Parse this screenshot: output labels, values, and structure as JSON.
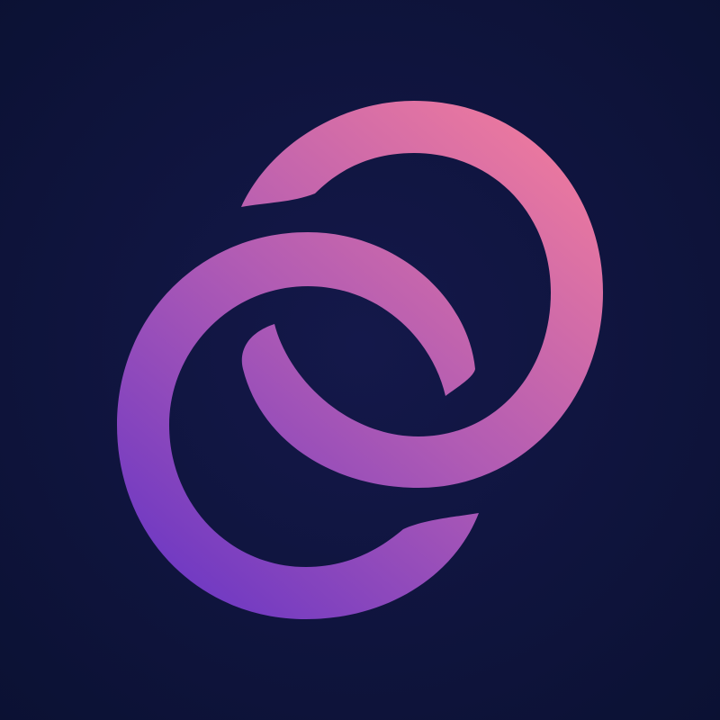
{
  "icon": {
    "name": "interlocking-rings-logo",
    "colors": {
      "background_center": "#14184a",
      "background_edge": "#0b1133",
      "gradient_top_right": "#ee7a9e",
      "gradient_mid": "#b05bb4",
      "gradient_bottom_left": "#6a36c4"
    }
  }
}
